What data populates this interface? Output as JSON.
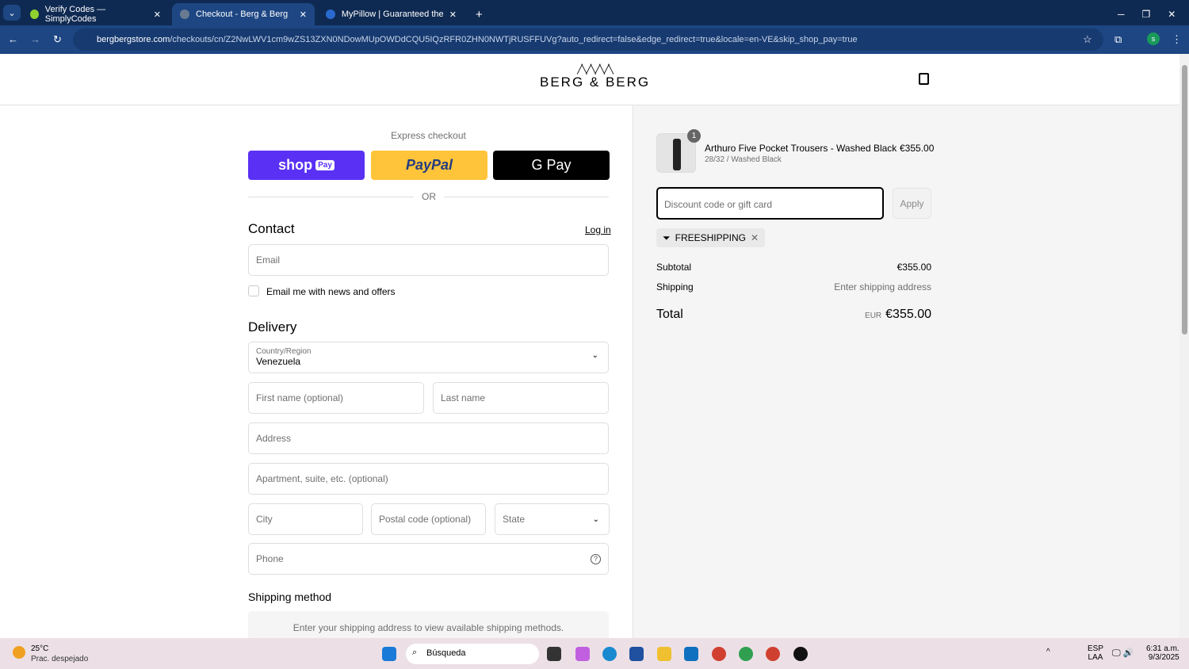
{
  "browser": {
    "tabs": [
      {
        "title": "Verify Codes — SimplyCodes"
      },
      {
        "title": "Checkout - Berg & Berg"
      },
      {
        "title": "MyPillow | Guaranteed the Mos"
      }
    ],
    "url_domain": "bergbergstore.com",
    "url_path": "/checkouts/cn/Z2NwLWV1cm9wZS13ZXN0NDowMUpOWDdCQU5IQzRFR0ZHN0NWTjRUSFFUVg?auto_redirect=false&edge_redirect=true&locale=en-VE&skip_shop_pay=true"
  },
  "header": {
    "logo": "BERG & BERG"
  },
  "checkout": {
    "express_label": "Express checkout",
    "shop_pay": "shop",
    "shop_pay_badge": "Pay",
    "paypal": "PayPal",
    "gpay": "G Pay",
    "or": "OR",
    "contact_title": "Contact",
    "login": "Log in",
    "email_placeholder": "Email",
    "newsletter": "Email me with news and offers",
    "delivery_title": "Delivery",
    "country_label": "Country/Region",
    "country_value": "Venezuela",
    "first_name": "First name (optional)",
    "last_name": "Last name",
    "address": "Address",
    "apartment": "Apartment, suite, etc. (optional)",
    "city": "City",
    "postal": "Postal code (optional)",
    "state": "State",
    "phone": "Phone",
    "shipping_method_title": "Shipping method",
    "shipping_method_note": "Enter your shipping address to view available shipping methods."
  },
  "summary": {
    "item": {
      "name": "Arthuro Five Pocket Trousers - Washed Black",
      "variant": "28/32 / Washed Black",
      "price": "€355.00",
      "qty": "1"
    },
    "discount_placeholder": "Discount code or gift card",
    "apply": "Apply",
    "code": "FREESHIPPING",
    "subtotal_label": "Subtotal",
    "subtotal": "€355.00",
    "shipping_label": "Shipping",
    "shipping": "Enter shipping address",
    "total_label": "Total",
    "currency": "EUR",
    "total": "€355.00"
  },
  "taskbar": {
    "temp": "25°C",
    "weather": "Prac. despejado",
    "search": "Búsqueda",
    "lang1": "ESP",
    "lang2": "LAA",
    "time": "6:31 a.m.",
    "date": "9/3/2025"
  }
}
